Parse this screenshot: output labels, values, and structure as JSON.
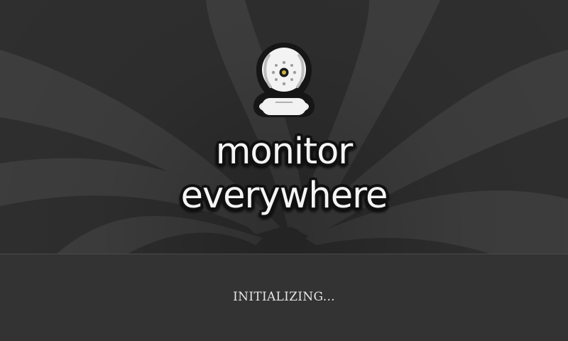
{
  "app": {
    "title_line1": "monitor",
    "title_line2": "everywhere",
    "logo_icon": "camera-icon"
  },
  "status": {
    "text": "INITIALIZING..."
  },
  "colors": {
    "background": "#333333",
    "swirl_light": "#3f3f3f",
    "title_text": "#f4f4f4",
    "status_text": "#e6e6e6"
  }
}
